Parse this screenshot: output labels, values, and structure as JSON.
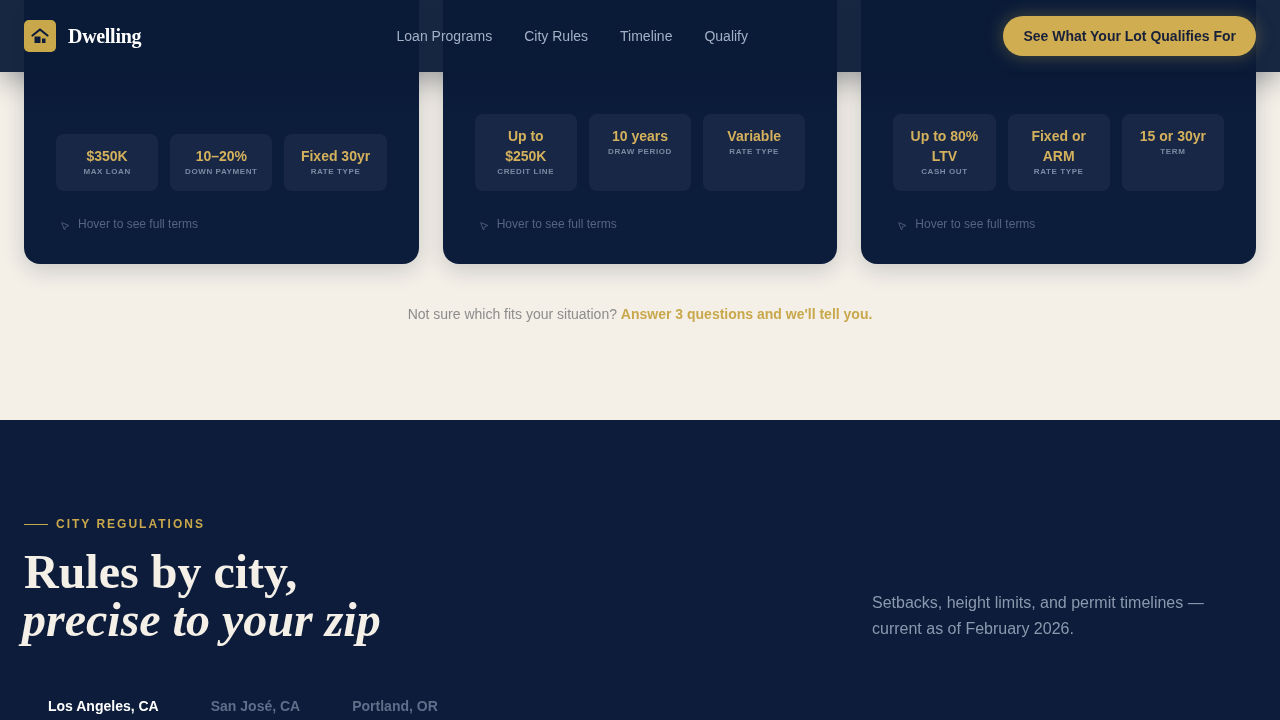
{
  "header": {
    "brand": "Dwelling",
    "nav": [
      "Loan Programs",
      "City Rules",
      "Timeline",
      "Qualify"
    ],
    "cta": "See What Your Lot Qualifies For"
  },
  "programs": [
    {
      "stats": [
        {
          "value": "$350K",
          "label": "MAX LOAN"
        },
        {
          "value": "10–20%",
          "label": "DOWN PAYMENT"
        },
        {
          "value": "Fixed 30yr",
          "label": "RATE TYPE"
        }
      ],
      "hint": "Hover to see full terms"
    },
    {
      "stats": [
        {
          "value": "Up to $250K",
          "label": "CREDIT LINE"
        },
        {
          "value": "10 years",
          "label": "DRAW PERIOD"
        },
        {
          "value": "Variable",
          "label": "RATE TYPE"
        }
      ],
      "hint": "Hover to see full terms"
    },
    {
      "stats": [
        {
          "value": "Up to 80% LTV",
          "label": "CASH OUT"
        },
        {
          "value": "Fixed or ARM",
          "label": "RATE TYPE"
        },
        {
          "value": "15 or 30yr",
          "label": "TERM"
        }
      ],
      "hint": "Hover to see full terms"
    }
  ],
  "fit_prompt": {
    "text": "Not sure which fits your situation?",
    "link": "Answer 3 questions and we'll tell you."
  },
  "city_rules": {
    "eyebrow": "CITY REGULATIONS",
    "title": "Rules by city, *precise to your zip*",
    "description": "Setbacks, height limits, and permit timelines — current as of February 2026.",
    "tabs": [
      {
        "label": "Los Angeles, CA",
        "selected": true
      },
      {
        "label": "San José, CA",
        "selected": false
      },
      {
        "label": "Portland, OR",
        "selected": false
      }
    ]
  }
}
